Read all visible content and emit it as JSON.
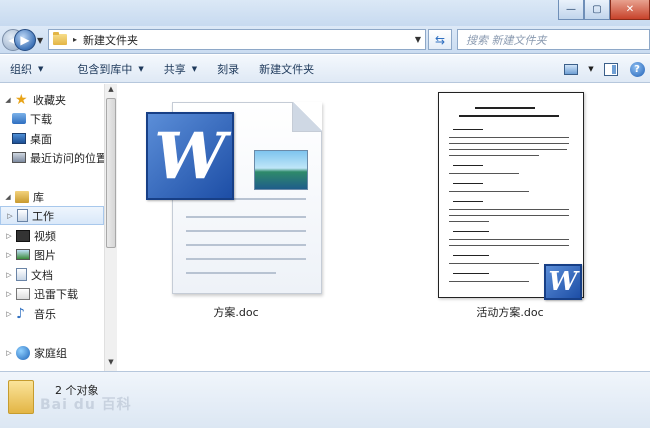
{
  "window": {
    "buttons": {
      "minimize": "—",
      "maximize": "▢",
      "close": "✕"
    }
  },
  "address": {
    "crumb_arrow": "▸",
    "path": "新建文件夹",
    "search_placeholder": "搜索 新建文件夹"
  },
  "toolbar": {
    "organize": "组织",
    "include_in_library": "包含到库中",
    "share": "共享",
    "burn": "刻录",
    "new_folder": "新建文件夹"
  },
  "sidebar": {
    "favorites": "收藏夹",
    "downloads": "下载",
    "desktop": "桌面",
    "recent": "最近访问的位置",
    "libraries": "库",
    "work": "工作",
    "videos": "视频",
    "pictures": "图片",
    "documents": "文档",
    "thunder": "迅雷下载",
    "music": "音乐",
    "homegroup": "家庭组"
  },
  "files": [
    {
      "name": "方案.doc",
      "icon": "word-doc-icon"
    },
    {
      "name": "活动方案.doc",
      "icon": "doc-thumbnail"
    }
  ],
  "status": {
    "count": "2 个对象",
    "watermark": "Bai du 百科"
  },
  "colors": {
    "accent": "#2f6fc0",
    "chrome": "#dbe8f6",
    "close": "#c7432b"
  }
}
